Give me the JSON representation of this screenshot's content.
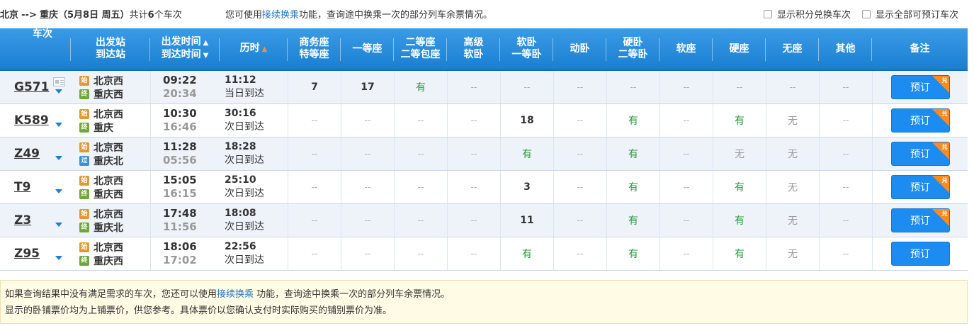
{
  "route": {
    "from": "北京",
    "arrow": "-->",
    "to": "重庆",
    "date": "（5月8日  周五）",
    "count_prefix": "共计",
    "count": "6",
    "count_suffix": "个车次"
  },
  "hint": {
    "prefix": "您可使用",
    "link": "接续换乘",
    "suffix": "功能，查询途中换乘一次的部分列车余票情况。"
  },
  "options": {
    "points_label": "显示积分兑换车次",
    "all_bookable_label": "显示全部可预订车次"
  },
  "headers": {
    "train": "车次",
    "station_from": "出发站",
    "station_to": "到达站",
    "time_dep": "出发时间",
    "time_arr": "到达时间",
    "duration": "历时",
    "biz_1": "商务座",
    "biz_2": "特等座",
    "first": "一等座",
    "second_1": "二等座",
    "second_2": "二等包座",
    "hsoft_1": "高级",
    "hsoft_2": "软卧",
    "soft_1": "软卧",
    "soft_2": "一等卧",
    "dong": "动卧",
    "hard_1": "硬卧",
    "hard_2": "二等卧",
    "softseat": "软座",
    "hardseat": "硬座",
    "noseat": "无座",
    "other": "其他",
    "note": "备注"
  },
  "booking": {
    "label": "预订",
    "tag": "兑"
  },
  "trains": [
    {
      "no": "G571",
      "from": "北京西",
      "from_tag": "始",
      "to": "重庆西",
      "to_tag": "终",
      "dep": "09:22",
      "arr": "20:34",
      "dur": "11:12",
      "arrday": "当日到达",
      "seats": [
        "7",
        "17",
        "有",
        "--",
        "--",
        "--",
        "--",
        "--",
        "--",
        "--",
        "--"
      ],
      "exchange": true
    },
    {
      "no": "K589",
      "from": "北京西",
      "from_tag": "始",
      "to": "重庆",
      "to_tag": "终",
      "dep": "10:30",
      "arr": "16:46",
      "dur": "30:16",
      "arrday": "次日到达",
      "seats": [
        "--",
        "--",
        "--",
        "--",
        "18",
        "--",
        "有",
        "--",
        "有",
        "无",
        "--"
      ],
      "exchange": true
    },
    {
      "no": "Z49",
      "from": "北京西",
      "from_tag": "始",
      "to": "重庆北",
      "to_tag": "过",
      "dep": "11:28",
      "arr": "05:56",
      "dur": "18:28",
      "arrday": "次日到达",
      "seats": [
        "--",
        "--",
        "--",
        "--",
        "有",
        "--",
        "有",
        "--",
        "无",
        "无",
        "--"
      ],
      "exchange": true
    },
    {
      "no": "T9",
      "from": "北京西",
      "from_tag": "始",
      "to": "重庆西",
      "to_tag": "终",
      "dep": "15:05",
      "arr": "16:15",
      "dur": "25:10",
      "arrday": "次日到达",
      "seats": [
        "--",
        "--",
        "--",
        "--",
        "3",
        "--",
        "有",
        "--",
        "有",
        "无",
        "--"
      ],
      "exchange": true
    },
    {
      "no": "Z3",
      "from": "北京西",
      "from_tag": "始",
      "to": "重庆北",
      "to_tag": "终",
      "dep": "17:48",
      "arr": "11:56",
      "dur": "18:08",
      "arrday": "次日到达",
      "seats": [
        "--",
        "--",
        "--",
        "--",
        "11",
        "--",
        "有",
        "--",
        "有",
        "无",
        "--"
      ],
      "exchange": true
    },
    {
      "no": "Z95",
      "from": "北京西",
      "from_tag": "始",
      "to": "重庆西",
      "to_tag": "终",
      "dep": "18:06",
      "arr": "17:02",
      "dur": "22:56",
      "arrday": "次日到达",
      "seats": [
        "--",
        "--",
        "--",
        "--",
        "有",
        "--",
        "有",
        "--",
        "有",
        "无",
        "--"
      ],
      "exchange": false
    }
  ],
  "footer": {
    "line1_prefix": "如果查询结果中没有满足需求的车次，您还可以使用",
    "line1_link": "接续换乘",
    "line1_suffix": " 功能，查询途中换乘一次的部分列车余票情况。",
    "line2": "显示的卧铺票价均为上铺票价，供您参考。具体票价以您确认支付时实际购买的铺别票价为准。"
  },
  "colors": {
    "header_blue": "#1a7fd2",
    "available_green": "#2a9a3a",
    "book_button": "#1d8cf0",
    "exchange_tag": "#ff8a1e"
  }
}
